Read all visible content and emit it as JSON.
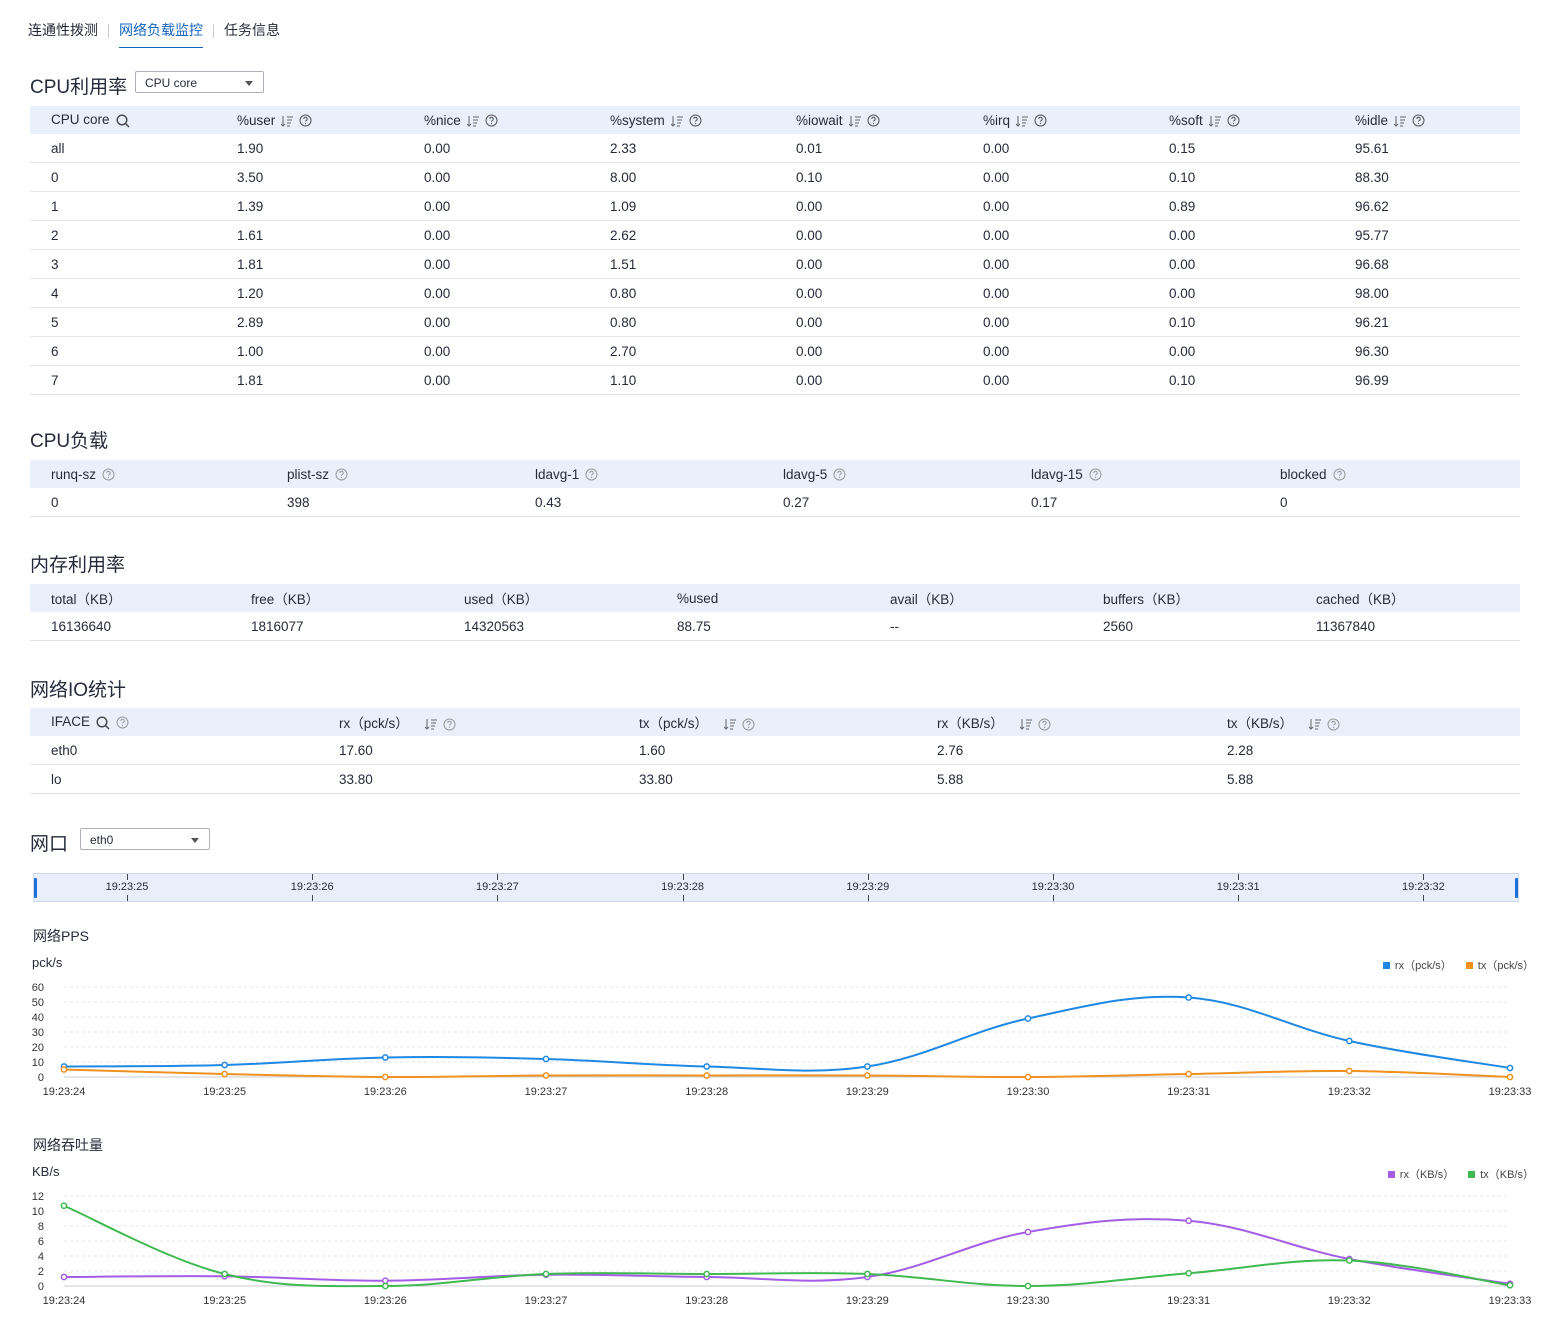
{
  "tabs": [
    {
      "label": "连通性拨测",
      "active": false
    },
    {
      "label": "网络负载监控",
      "active": true
    },
    {
      "label": "任务信息",
      "active": false
    }
  ],
  "cpu_util": {
    "title": "CPU利用率",
    "select": "CPU core",
    "columns": [
      "CPU core",
      "%user",
      "%nice",
      "%system",
      "%iowait",
      "%irq",
      "%soft",
      "%idle"
    ],
    "rows": [
      [
        "all",
        "1.90",
        "0.00",
        "2.33",
        "0.01",
        "0.00",
        "0.15",
        "95.61"
      ],
      [
        "0",
        "3.50",
        "0.00",
        "8.00",
        "0.10",
        "0.00",
        "0.10",
        "88.30"
      ],
      [
        "1",
        "1.39",
        "0.00",
        "1.09",
        "0.00",
        "0.00",
        "0.89",
        "96.62"
      ],
      [
        "2",
        "1.61",
        "0.00",
        "2.62",
        "0.00",
        "0.00",
        "0.00",
        "95.77"
      ],
      [
        "3",
        "1.81",
        "0.00",
        "1.51",
        "0.00",
        "0.00",
        "0.00",
        "96.68"
      ],
      [
        "4",
        "1.20",
        "0.00",
        "0.80",
        "0.00",
        "0.00",
        "0.00",
        "98.00"
      ],
      [
        "5",
        "2.89",
        "0.00",
        "0.80",
        "0.00",
        "0.00",
        "0.10",
        "96.21"
      ],
      [
        "6",
        "1.00",
        "0.00",
        "2.70",
        "0.00",
        "0.00",
        "0.00",
        "96.30"
      ],
      [
        "7",
        "1.81",
        "0.00",
        "1.10",
        "0.00",
        "0.00",
        "0.10",
        "96.99"
      ]
    ]
  },
  "cpu_load": {
    "title": "CPU负载",
    "columns": [
      "runq-sz",
      "plist-sz",
      "ldavg-1",
      "ldavg-5",
      "ldavg-15",
      "blocked"
    ],
    "rows": [
      [
        "0",
        "398",
        "0.43",
        "0.27",
        "0.17",
        "0"
      ]
    ]
  },
  "memory": {
    "title": "内存利用率",
    "columns": [
      "total（KB）",
      "free（KB）",
      "used（KB）",
      "%used",
      "avail（KB）",
      "buffers（KB）",
      "cached（KB）"
    ],
    "rows": [
      [
        "16136640",
        "1816077",
        "14320563",
        "88.75",
        "--",
        "2560",
        "11367840"
      ]
    ]
  },
  "netio": {
    "title": "网络IO统计",
    "columns": [
      "IFACE",
      "rx（pck/s）",
      "tx（pck/s）",
      "rx（KB/s）",
      "tx（KB/s）"
    ],
    "rows": [
      [
        "eth0",
        "17.60",
        "1.60",
        "2.76",
        "2.28"
      ],
      [
        "lo",
        "33.80",
        "33.80",
        "5.88",
        "5.88"
      ]
    ]
  },
  "port": {
    "title": "网口",
    "select": "eth0"
  },
  "timeline": {
    "labels": [
      "19:23:25",
      "19:23:26",
      "19:23:27",
      "19:23:28",
      "19:23:29",
      "19:23:30",
      "19:23:31",
      "19:23:32"
    ]
  },
  "colors": {
    "accent": "#1565c0",
    "rx_pps": "#1e88e5",
    "tx_pps": "#f0901e",
    "rx_kbs": "#a55de6",
    "tx_kbs": "#3fb950"
  },
  "chart_data": [
    {
      "type": "line",
      "title": "网络PPS",
      "ylabel": "pck/s",
      "x": [
        "19:23:24",
        "19:23:25",
        "19:23:26",
        "19:23:27",
        "19:23:28",
        "19:23:29",
        "19:23:30",
        "19:23:31",
        "19:23:32",
        "19:23:33"
      ],
      "ylim": [
        0,
        60
      ],
      "yticks": [
        0,
        10,
        20,
        30,
        40,
        50,
        60
      ],
      "grid": true,
      "legend": "top-right",
      "series": [
        {
          "name": "rx（pck/s）",
          "color": "#1e88e5",
          "values": [
            7,
            8,
            13,
            12,
            7,
            7,
            39,
            53,
            24,
            6
          ]
        },
        {
          "name": "tx（pck/s）",
          "color": "#f0901e",
          "values": [
            5,
            2,
            0,
            1,
            1,
            1,
            0,
            2,
            4,
            0
          ]
        }
      ]
    },
    {
      "type": "line",
      "title": "网络吞吐量",
      "ylabel": "KB/s",
      "x": [
        "19:23:24",
        "19:23:25",
        "19:23:26",
        "19:23:27",
        "19:23:28",
        "19:23:29",
        "19:23:30",
        "19:23:31",
        "19:23:32",
        "19:23:33"
      ],
      "ylim": [
        0,
        12
      ],
      "yticks": [
        0,
        2,
        4,
        6,
        8,
        10,
        12
      ],
      "grid": true,
      "legend": "top-right",
      "series": [
        {
          "name": "rx（KB/s）",
          "color": "#a55de6",
          "values": [
            1.2,
            1.3,
            0.7,
            1.5,
            1.2,
            1.2,
            7.2,
            8.7,
            3.6,
            0.3
          ]
        },
        {
          "name": "tx（KB/s）",
          "color": "#3fb950",
          "values": [
            10.7,
            1.6,
            0.0,
            1.6,
            1.6,
            1.6,
            0.0,
            1.7,
            3.4,
            0.1
          ]
        }
      ]
    }
  ]
}
